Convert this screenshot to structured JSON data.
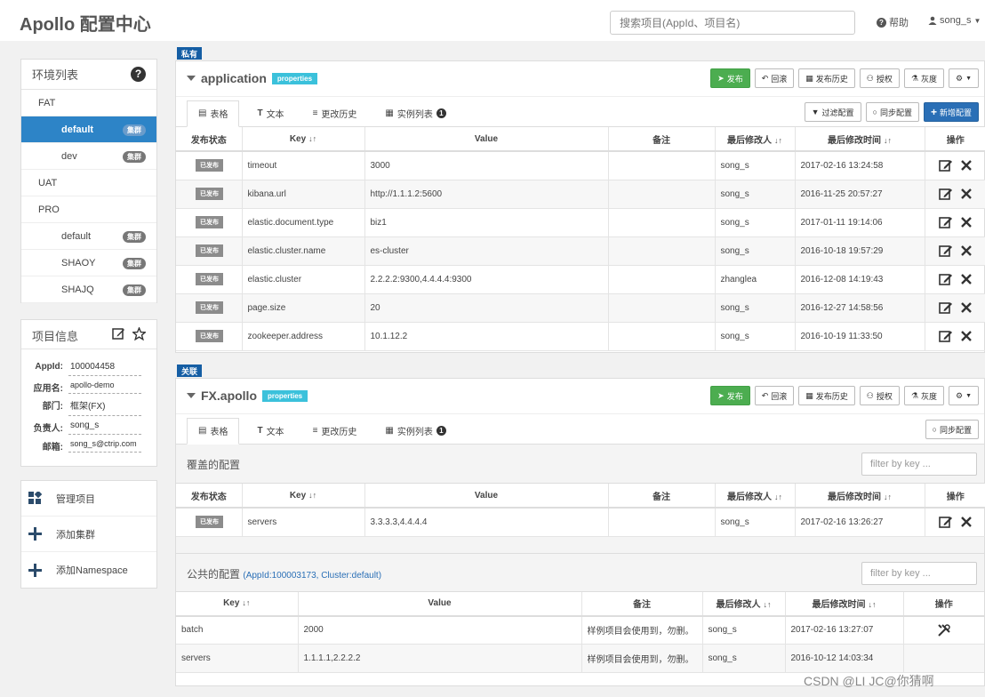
{
  "header": {
    "logo": "Apollo 配置中心",
    "search_placeholder": "搜索项目(AppId、项目名)",
    "help": "帮助",
    "user": "song_s"
  },
  "env_panel": {
    "title": "环境列表",
    "rows": [
      {
        "label": "FAT",
        "kind": "env",
        "badge": ""
      },
      {
        "label": "default",
        "kind": "cluster",
        "badge": "集群",
        "active": true
      },
      {
        "label": "dev",
        "kind": "cluster",
        "badge": "集群"
      },
      {
        "label": "UAT",
        "kind": "env",
        "badge": ""
      },
      {
        "label": "PRO",
        "kind": "env",
        "badge": ""
      },
      {
        "label": "default",
        "kind": "cluster",
        "badge": "集群"
      },
      {
        "label": "SHAOY",
        "kind": "cluster",
        "badge": "集群"
      },
      {
        "label": "SHAJQ",
        "kind": "cluster",
        "badge": "集群"
      }
    ]
  },
  "info_panel": {
    "title": "项目信息",
    "rows": [
      {
        "label": "AppId:",
        "value": "100004458"
      },
      {
        "label": "应用名:",
        "value": "apollo-demo"
      },
      {
        "label": "部门:",
        "value": "框架(FX)"
      },
      {
        "label": "负责人:",
        "value": "song_s"
      },
      {
        "label": "邮箱:",
        "value": "song_s@ctrip.com"
      }
    ]
  },
  "actions": [
    "管理项目",
    "添加集群",
    "添加Namespace"
  ],
  "ns1": {
    "tag": "私有",
    "title": "application",
    "format": "properties",
    "buttons": {
      "publish": "发布",
      "rollback": "回滚",
      "history": "发布历史",
      "auth": "授权",
      "gray": "灰度"
    },
    "tabs": [
      "表格",
      "文本",
      "更改历史",
      "实例列表"
    ],
    "tab_count": "1",
    "tab_buttons": {
      "filter": "过滤配置",
      "sync": "同步配置",
      "add": "新增配置"
    },
    "columns": [
      "发布状态",
      "Key",
      "Value",
      "备注",
      "最后修改人",
      "最后修改时间",
      "操作"
    ],
    "status_label": "已发布",
    "rows": [
      {
        "key": "timeout",
        "value": "3000",
        "comment": "",
        "user": "song_s",
        "time": "2017-02-16 13:24:58"
      },
      {
        "key": "kibana.url",
        "value": "http://1.1.1.2:5600",
        "comment": "",
        "user": "song_s",
        "time": "2016-11-25 20:57:27"
      },
      {
        "key": "elastic.document.type",
        "value": "biz1",
        "comment": "",
        "user": "song_s",
        "time": "2017-01-11 19:14:06"
      },
      {
        "key": "elastic.cluster.name",
        "value": "es-cluster",
        "comment": "",
        "user": "song_s",
        "time": "2016-10-18 19:57:29"
      },
      {
        "key": "elastic.cluster",
        "value": "2.2.2.2:9300,4.4.4.4:9300",
        "comment": "",
        "user": "zhanglea",
        "time": "2016-12-08 14:19:43"
      },
      {
        "key": "page.size",
        "value": "20",
        "comment": "",
        "user": "song_s",
        "time": "2016-12-27 14:58:56"
      },
      {
        "key": "zookeeper.address",
        "value": "10.1.12.2",
        "comment": "",
        "user": "song_s",
        "time": "2016-10-19 11:33:50"
      }
    ]
  },
  "ns2": {
    "tag": "关联",
    "title": "FX.apollo",
    "format": "properties",
    "buttons": {
      "publish": "发布",
      "rollback": "回滚",
      "history": "发布历史",
      "auth": "授权",
      "gray": "灰度"
    },
    "tabs": [
      "表格",
      "文本",
      "更改历史",
      "实例列表"
    ],
    "tab_count": "1",
    "tab_buttons": {
      "sync": "同步配置"
    },
    "override_title": "覆盖的配置",
    "filter_placeholder": "filter by key ...",
    "columns": [
      "发布状态",
      "Key",
      "Value",
      "备注",
      "最后修改人",
      "最后修改时间",
      "操作"
    ],
    "status_label": "已发布",
    "rows": [
      {
        "key": "servers",
        "value": "3.3.3.3,4.4.4.4",
        "comment": "",
        "user": "song_s",
        "time": "2017-02-16 13:26:27"
      }
    ],
    "public_title": "公共的配置",
    "public_link": "(AppId:100003173, Cluster:default)",
    "public_columns": [
      "Key",
      "Value",
      "备注",
      "最后修改人",
      "最后修改时间",
      "操作"
    ],
    "public_rows": [
      {
        "key": "batch",
        "value": "2000",
        "comment": "样例项目会使用到，勿删。",
        "user": "song_s",
        "time": "2017-02-16 13:27:07"
      },
      {
        "key": "servers",
        "value": "1.1.1.1,2.2.2.2",
        "comment": "样例项目会使用到，勿删。",
        "user": "song_s",
        "time": "2016-10-12 14:03:34"
      }
    ]
  },
  "watermark": "CSDN @LI JC@你猜啊"
}
